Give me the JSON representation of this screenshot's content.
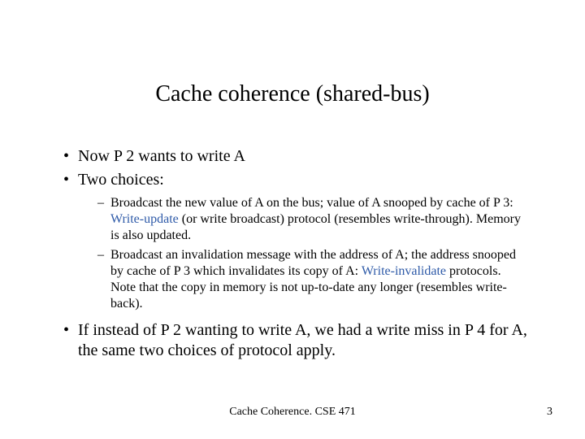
{
  "title": "Cache coherence (shared-bus)",
  "bullets": {
    "b1": "Now P 2 wants to write A",
    "b2": "Two choices:",
    "b3": "If instead of P 2 wanting to write A, we had a write miss in P 4 for A, the same two choices of protocol apply."
  },
  "sub": {
    "s1a": "Broadcast the new value of A on the bus; value of A snooped by cache of P 3: ",
    "s1kw": "Write-update",
    "s1b": " (or write broadcast) protocol (resembles write-through). Memory is also updated.",
    "s2a": "Broadcast an invalidation message with the address of A; the address snooped by cache of P 3 which invalidates its copy of A: ",
    "s2kw": "Write-invalidate",
    "s2b": " protocols. Note that the copy in memory is not up-to-date any longer (resembles write-back)."
  },
  "footer": {
    "center": "Cache Coherence.  CSE 471",
    "page": "3"
  },
  "colors": {
    "keyword": "#2e5aa8"
  }
}
